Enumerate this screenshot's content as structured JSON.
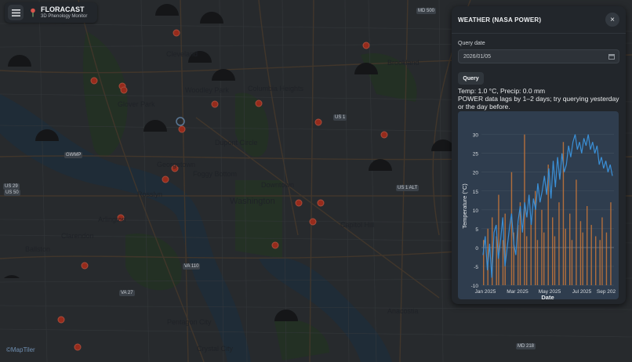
{
  "app": {
    "name": "FLORACAST",
    "subtitle": "3D Phenology Monitor"
  },
  "map": {
    "labels": [
      {
        "text": "Washington",
        "cls": "big"
      },
      {
        "text": "Arlington",
        "cls": ""
      },
      {
        "text": "Cleveland",
        "cls": ""
      },
      {
        "text": "Woodley Park",
        "cls": ""
      },
      {
        "text": "Columbia Heights",
        "cls": ""
      },
      {
        "text": "Glover Park",
        "cls": ""
      },
      {
        "text": "Georgetown",
        "cls": ""
      },
      {
        "text": "Foggy Bottom",
        "cls": ""
      },
      {
        "text": "Dupont Circle",
        "cls": ""
      },
      {
        "text": "Downtown",
        "cls": ""
      },
      {
        "text": "Capitol Hill",
        "cls": ""
      },
      {
        "text": "Brookland",
        "cls": ""
      },
      {
        "text": "Rosslyn",
        "cls": ""
      },
      {
        "text": "Clarendon",
        "cls": ""
      },
      {
        "text": "Ballston",
        "cls": ""
      },
      {
        "text": "Pentagon City",
        "cls": ""
      },
      {
        "text": "Crystal City",
        "cls": ""
      },
      {
        "text": "Anacostia",
        "cls": ""
      }
    ],
    "badges": [
      "US 29",
      "GWMP",
      "US 50",
      "VA 110",
      "VA 27",
      "US 1",
      "MD 500",
      "US 1 ALT",
      "MD 218"
    ],
    "attribution": "©MapTiler"
  },
  "panel": {
    "title": "WEATHER (NASA POWER)",
    "close_label": "×",
    "query_label": "Query date",
    "query_value": "2026/01/05",
    "query_button": "Query",
    "result_line1": "Temp: 1.0 °C, Precip: 0.0 mm",
    "result_line2": "POWER data lags by 1–2 days; try querying yesterday or the day before."
  },
  "chart_data": {
    "type": "line",
    "xlabel": "Date",
    "ylabel": "Temperature (°C)",
    "ylim": [
      -10,
      32
    ],
    "yticks": [
      -10,
      -5,
      0,
      5,
      10,
      15,
      20,
      25,
      30
    ],
    "xticks": [
      "Jan 2025",
      "Mar 2025",
      "May 2025",
      "Jul 2025",
      "Sep 202"
    ],
    "series": [
      {
        "color": "#3a8fd6",
        "kind": "line",
        "x_start": "2025-01-01",
        "x_end": "2025-09-20",
        "values": [
          -2,
          3,
          -6,
          1,
          -8,
          4,
          6,
          -3,
          2,
          8,
          -5,
          0,
          5,
          9,
          1,
          -2,
          7,
          11,
          4,
          12,
          8,
          14,
          6,
          13,
          10,
          17,
          12,
          15,
          19,
          14,
          21,
          13,
          23,
          16,
          24,
          18,
          25,
          20,
          22,
          27,
          24,
          28,
          30,
          26,
          28,
          25,
          29,
          27,
          30,
          26,
          28,
          25,
          27,
          22,
          24,
          21,
          23,
          20,
          22,
          19
        ]
      },
      {
        "color": "#c9773a",
        "kind": "bar",
        "values": [
          2,
          0,
          5,
          0,
          8,
          0,
          3,
          14,
          0,
          2,
          9,
          0,
          0,
          20,
          4,
          0,
          6,
          12,
          0,
          30,
          3,
          0,
          7,
          0,
          15,
          2,
          0,
          10,
          4,
          0,
          22,
          0,
          8,
          3,
          0,
          12,
          0,
          28,
          5,
          0,
          9,
          2,
          0,
          18,
          0,
          7,
          4,
          0,
          11,
          0,
          6,
          0,
          3,
          0,
          2,
          8,
          0,
          4,
          0,
          12
        ]
      }
    ]
  }
}
